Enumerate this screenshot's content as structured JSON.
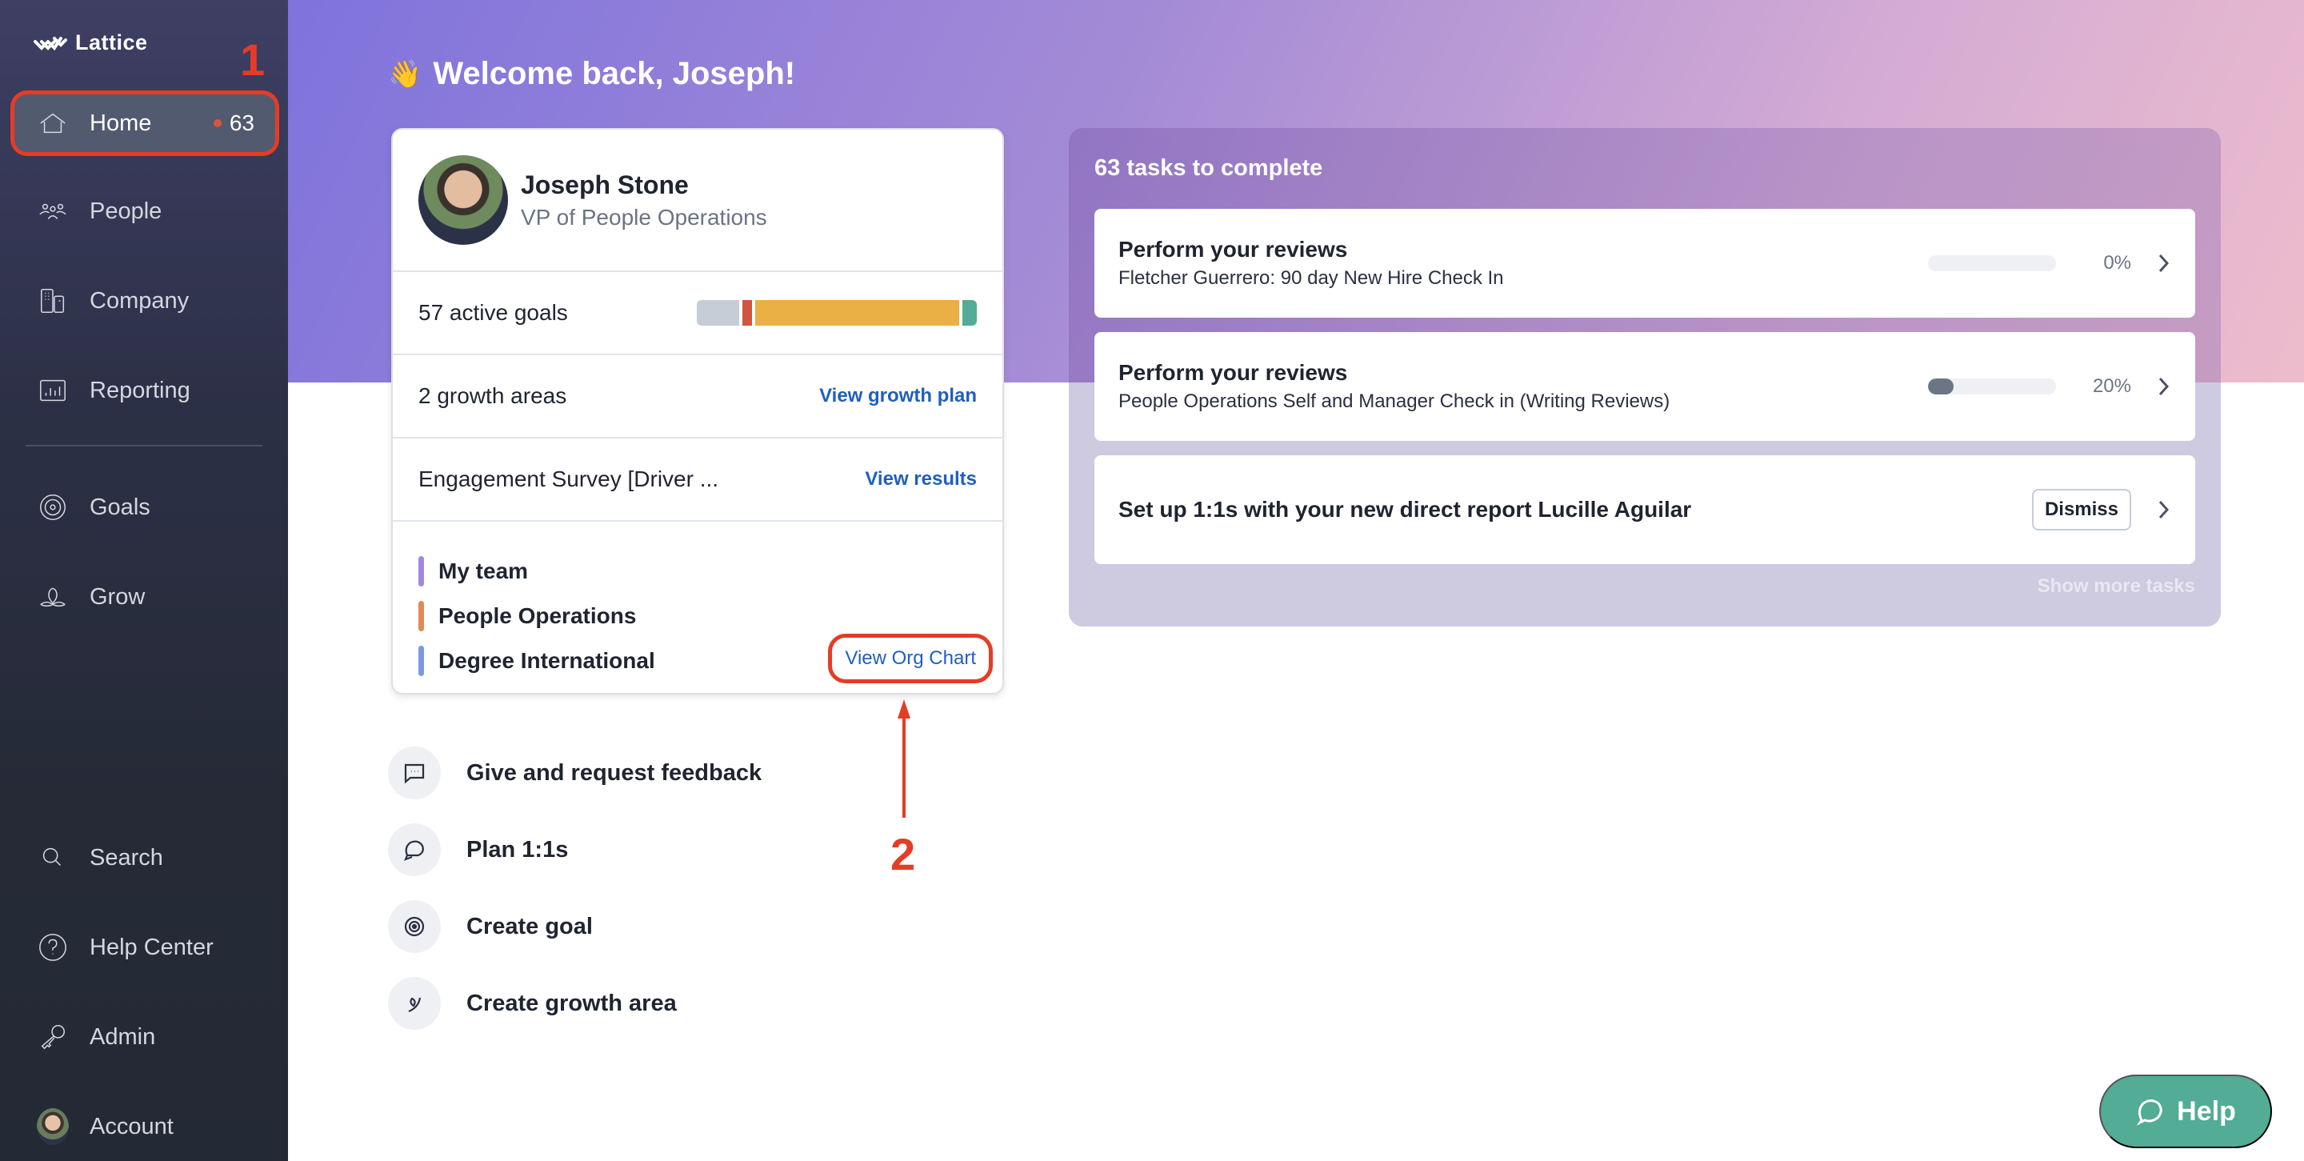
{
  "app": {
    "name": "Lattice"
  },
  "sidebar": {
    "items": [
      {
        "label": "Home",
        "icon": "home-icon",
        "active": true,
        "badge": "63"
      },
      {
        "label": "People",
        "icon": "people-icon"
      },
      {
        "label": "Company",
        "icon": "building-icon"
      },
      {
        "label": "Reporting",
        "icon": "chart-icon"
      },
      {
        "label": "Goals",
        "icon": "target-icon"
      },
      {
        "label": "Grow",
        "icon": "grow-icon"
      }
    ],
    "bottom_items": [
      {
        "label": "Search",
        "icon": "search-icon"
      },
      {
        "label": "Help Center",
        "icon": "question-icon"
      },
      {
        "label": "Admin",
        "icon": "key-icon"
      },
      {
        "label": "Account",
        "icon": "avatar"
      }
    ]
  },
  "annotations": {
    "one": "1",
    "two": "2",
    "color": "#e63c25"
  },
  "welcome": {
    "emoji": "👋",
    "text": "Welcome back, Joseph!"
  },
  "profile": {
    "name": "Joseph Stone",
    "title": "VP of People Operations",
    "goals": {
      "label": "57 active goals",
      "segments": [
        {
          "status": "not-started",
          "count": 9,
          "color": "#c6cdd6"
        },
        {
          "status": "off-track",
          "count": 2,
          "color": "#d15640"
        },
        {
          "status": "progressing",
          "count": 43,
          "color": "#eab045"
        },
        {
          "status": "on-track",
          "count": 3,
          "color": "#52ac96"
        }
      ]
    },
    "growth": {
      "label": "2 growth areas",
      "link": "View growth plan"
    },
    "survey": {
      "label": "Engagement Survey [Driver ...",
      "link": "View results"
    },
    "teams": [
      {
        "name": "My team",
        "color": "#a287e0"
      },
      {
        "name": "People Operations",
        "color": "#e28a57"
      },
      {
        "name": "Degree International",
        "color": "#7a98e2"
      }
    ],
    "org_chart_link": "View Org Chart"
  },
  "quick_actions": [
    {
      "label": "Give and request feedback",
      "icon": "feedback-icon"
    },
    {
      "label": "Plan 1:1s",
      "icon": "chat-icon"
    },
    {
      "label": "Create goal",
      "icon": "target-icon"
    },
    {
      "label": "Create growth area",
      "icon": "sprout-icon"
    }
  ],
  "tasks": {
    "title": "63 tasks to complete",
    "items": [
      {
        "title": "Perform your reviews",
        "subtitle": "Fletcher Guerrero: 90 day New Hire Check In",
        "progress": 0,
        "progress_label": "0%"
      },
      {
        "title": "Perform your reviews",
        "subtitle": "People Operations Self and Manager Check in (Writing Reviews)",
        "progress": 20,
        "progress_label": "20%"
      },
      {
        "title": "Set up 1:1s with your new direct report Lucille Aguilar",
        "action": "Dismiss"
      }
    ],
    "show_more": "Show more tasks"
  },
  "help_button": {
    "label": "Help"
  }
}
